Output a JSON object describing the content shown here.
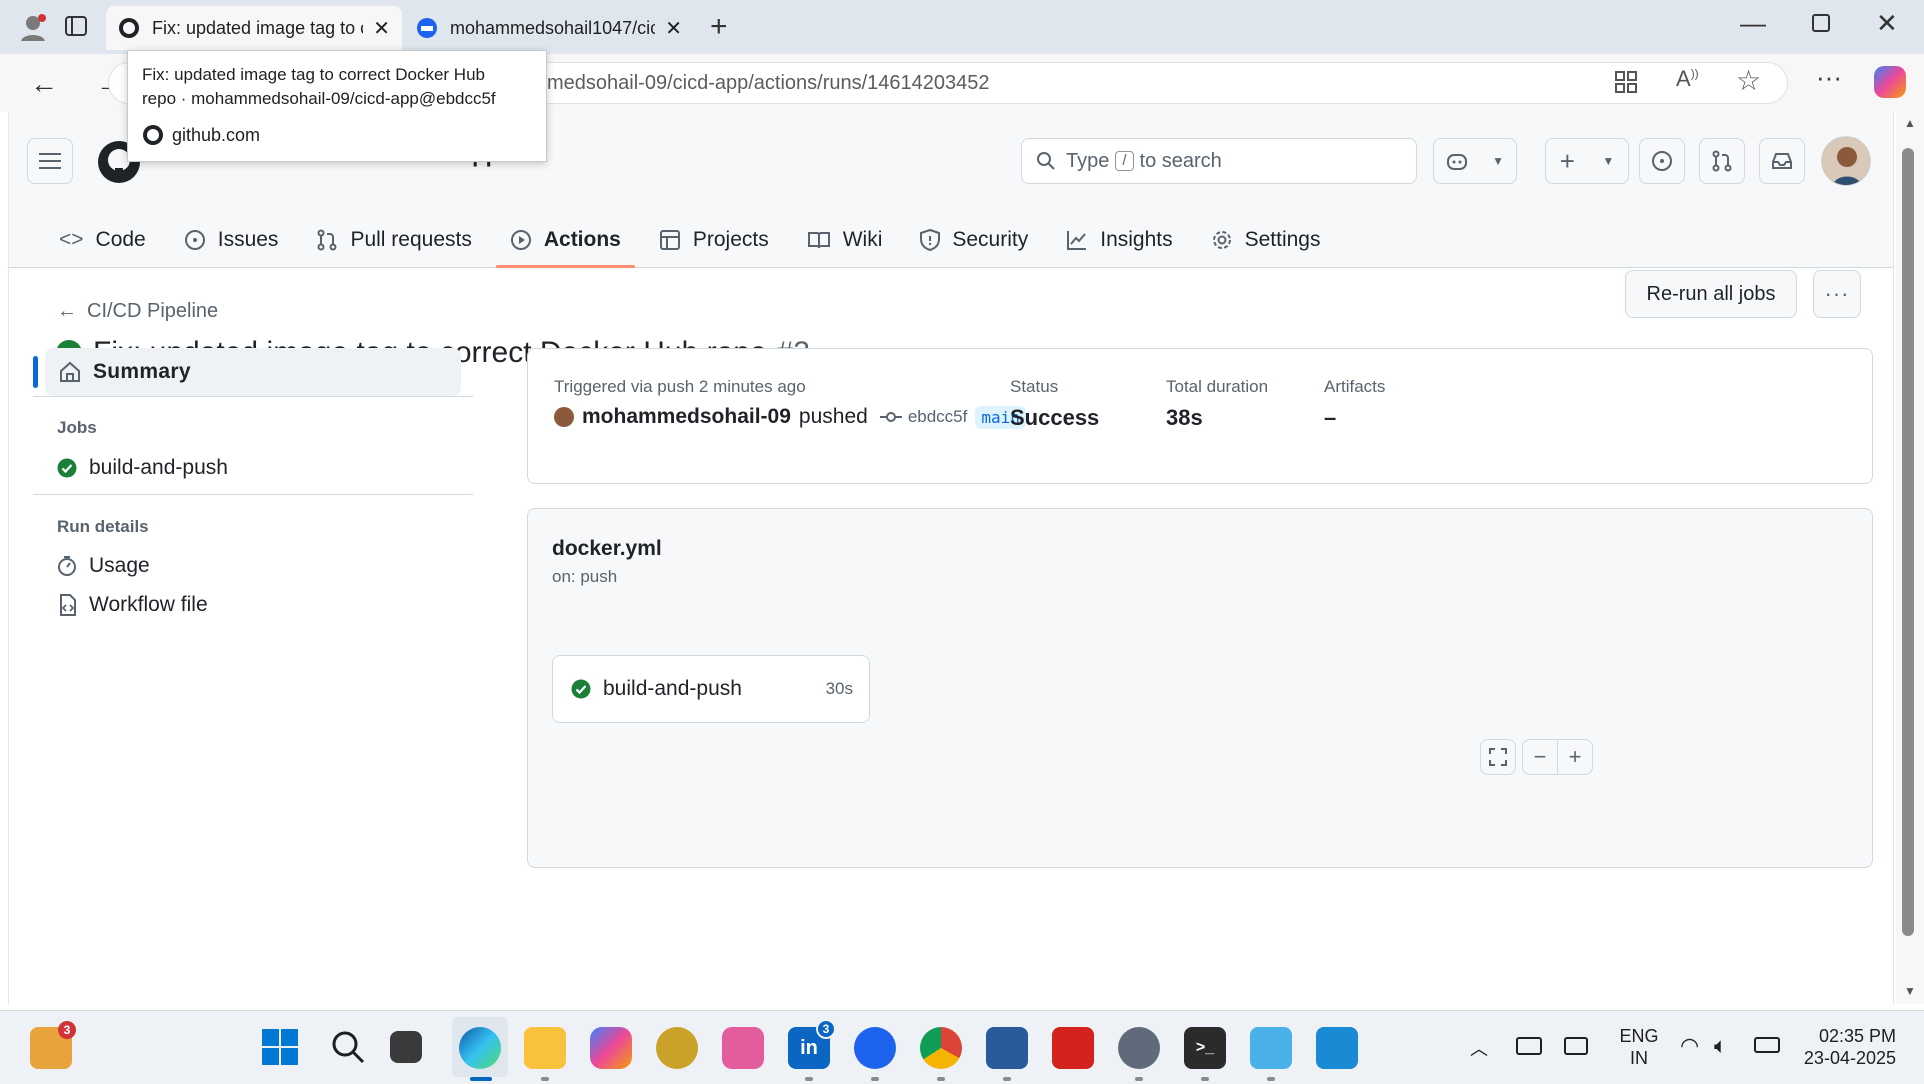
{
  "browser": {
    "tabs": [
      {
        "title": "Fix: updated image tag to correct",
        "active": true
      },
      {
        "title": "mohammedsohail1047/cicd-app",
        "active": false
      }
    ],
    "url": "medsohail-09/cicd-app/actions/runs/14614203452",
    "tooltip": {
      "line1": "Fix: updated image tag to correct Docker Hub",
      "line2": "repo · mohammedsohail-09/cicd-app@ebdcc5f",
      "site": "github.com"
    }
  },
  "header": {
    "repo_owner": "mohammedsohail-09",
    "separator": "/",
    "repo_name": "cicd-app",
    "search_prefix": "Type",
    "search_key": "/",
    "search_suffix": "to search"
  },
  "nav": {
    "tabs": [
      {
        "label": "Code"
      },
      {
        "label": "Issues"
      },
      {
        "label": "Pull requests"
      },
      {
        "label": "Actions",
        "active": true
      },
      {
        "label": "Projects"
      },
      {
        "label": "Wiki"
      },
      {
        "label": "Security"
      },
      {
        "label": "Insights"
      },
      {
        "label": "Settings"
      }
    ]
  },
  "run": {
    "workflow_link": "CI/CD Pipeline",
    "title": "Fix: updated image tag to correct Docker Hub repo",
    "number": "#3",
    "rerun_label": "Re-run all jobs"
  },
  "sidebar": {
    "summary": "Summary",
    "jobs_heading": "Jobs",
    "job": "build-and-push",
    "run_details_heading": "Run details",
    "usage": "Usage",
    "workflow_file": "Workflow file"
  },
  "summary_card": {
    "trigger_text": "Triggered via push 2 minutes ago",
    "actor": "mohammedsohail-09",
    "action": "pushed",
    "commit": "ebdcc5f",
    "branch": "main",
    "status_label": "Status",
    "status_value": "Success",
    "duration_label": "Total duration",
    "duration_value": "38s",
    "artifacts_label": "Artifacts",
    "artifacts_value": "–"
  },
  "workflow_card": {
    "file": "docker.yml",
    "trigger": "on: push",
    "job_name": "build-and-push",
    "job_duration": "30s"
  },
  "taskbar": {
    "notif_badge": "3",
    "linkedin_badge": "3",
    "lang_top": "ENG",
    "lang_bottom": "IN",
    "time": "02:35 PM",
    "date": "23-04-2025"
  },
  "colors": {
    "success": "#1a7f37",
    "accent_underline": "#fd8c73",
    "link_blue": "#0969da"
  }
}
